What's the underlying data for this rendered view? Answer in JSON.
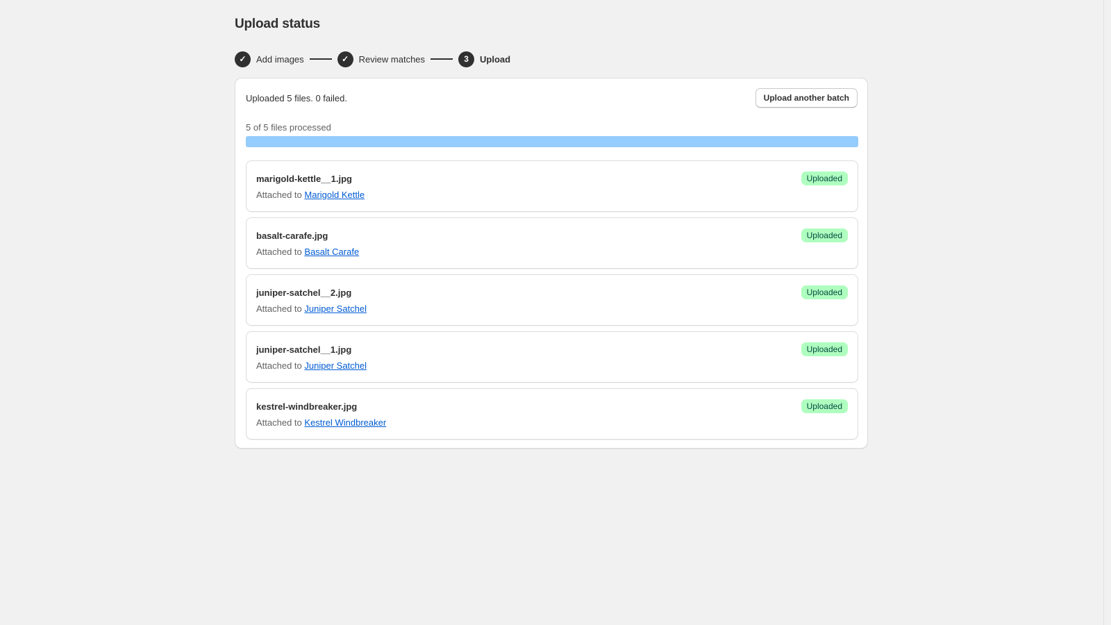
{
  "page": {
    "title": "Upload status"
  },
  "stepper": {
    "steps": [
      {
        "label": "Add images",
        "marker": "✓",
        "state": "complete"
      },
      {
        "label": "Review matches",
        "marker": "✓",
        "state": "complete"
      },
      {
        "label": "Upload",
        "marker": "3",
        "state": "current"
      }
    ]
  },
  "summary": {
    "text": "Uploaded 5 files. 0 failed.",
    "action_label": "Upload another batch"
  },
  "progress": {
    "label": "5 of 5 files processed",
    "fraction": 1.0
  },
  "files": [
    {
      "name": "marigold-kettle__1.jpg",
      "attached_prefix": "Attached to",
      "product": "Marigold Kettle",
      "status": "Uploaded"
    },
    {
      "name": "basalt-carafe.jpg",
      "attached_prefix": "Attached to",
      "product": "Basalt Carafe",
      "status": "Uploaded"
    },
    {
      "name": "juniper-satchel__2.jpg",
      "attached_prefix": "Attached to",
      "product": "Juniper Satchel",
      "status": "Uploaded"
    },
    {
      "name": "juniper-satchel__1.jpg",
      "attached_prefix": "Attached to",
      "product": "Juniper Satchel",
      "status": "Uploaded"
    },
    {
      "name": "kestrel-windbreaker.jpg",
      "attached_prefix": "Attached to",
      "product": "Kestrel Windbreaker",
      "status": "Uploaded"
    }
  ],
  "colors": {
    "background": "#f1f1f1",
    "progress_fill": "#94ccfd",
    "success_badge": "#affebf",
    "link": "#005bd3",
    "step_marker": "#303030"
  }
}
